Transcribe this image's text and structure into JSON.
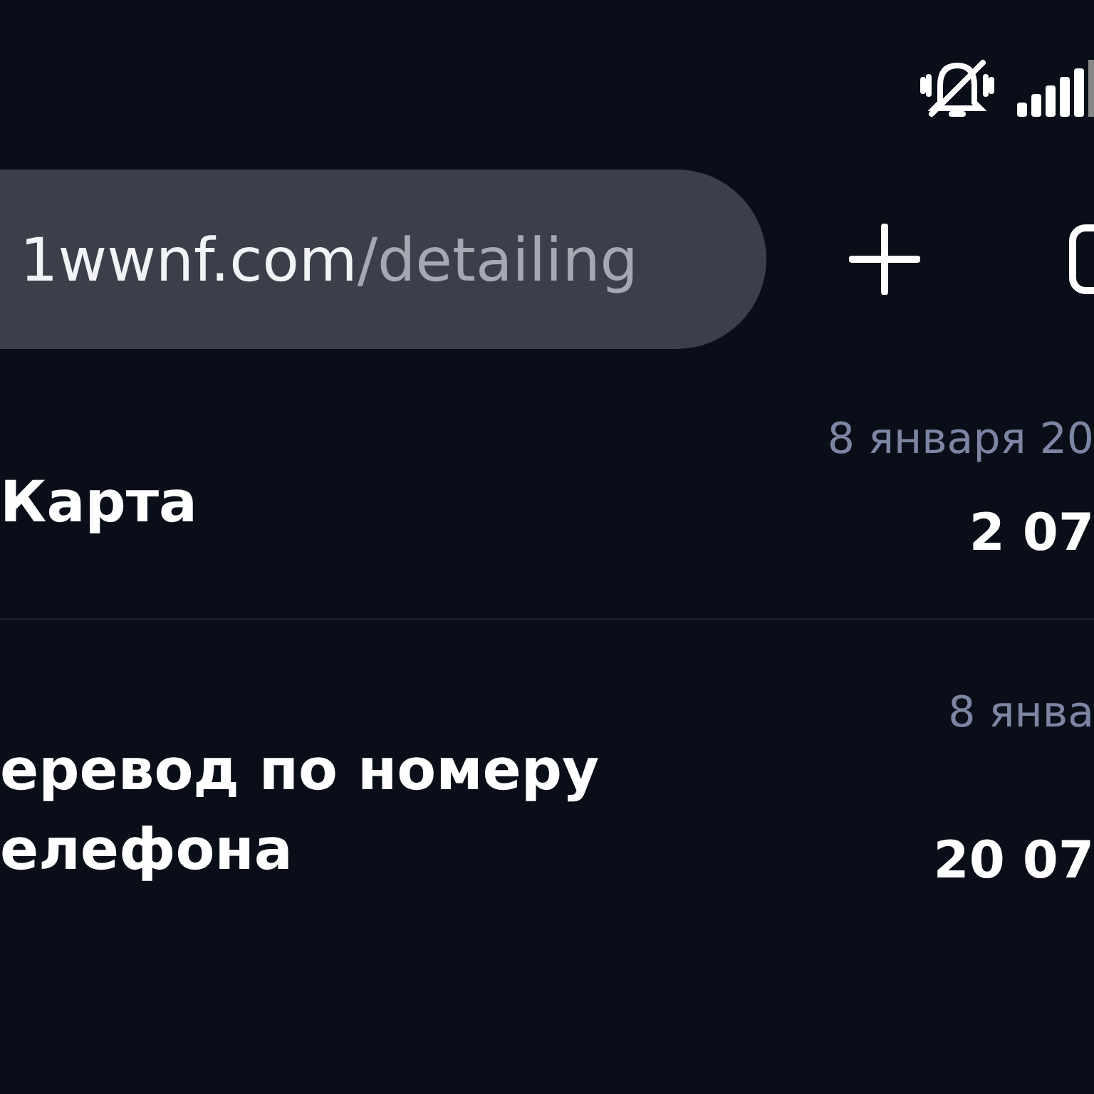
{
  "address_bar": {
    "domain": "1wwnf.com",
    "path": "/detailing"
  },
  "transactions": [
    {
      "title": "Карта",
      "date": "8 января 20",
      "amount": "2 07"
    },
    {
      "title": "еревод по номеру елефона",
      "date": "8 янва",
      "amount": "20 07"
    }
  ]
}
